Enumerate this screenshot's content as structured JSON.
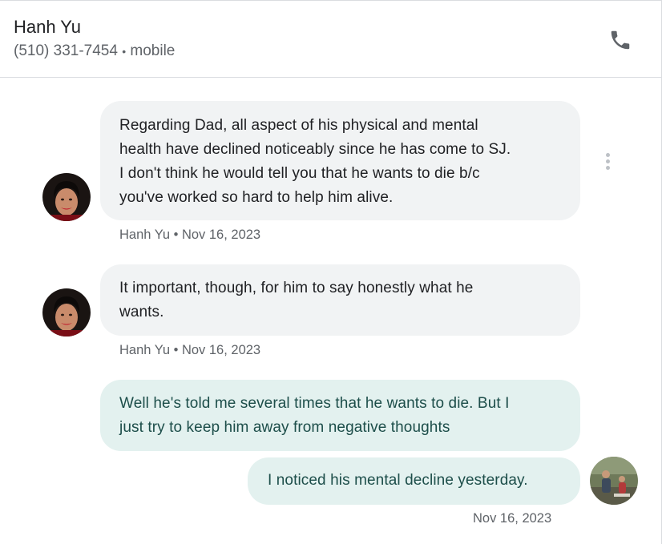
{
  "header": {
    "contact_name": "Hanh Yu",
    "phone": "(510) 331-7454",
    "phone_type": "mobile",
    "separator": "•",
    "call_icon": "phone-icon"
  },
  "messages": [
    {
      "direction": "incoming",
      "lines": [
        "Regarding Dad, all aspect of his physical and mental",
        "health have declined noticeably since he has come to SJ.",
        "I don't think he would tell you that he wants to die b/c",
        "you've worked so hard to help him alive."
      ],
      "meta": "Hanh Yu • Nov 16, 2023"
    },
    {
      "direction": "incoming",
      "lines": [
        "It important, though, for  him to say honestly what he",
        "wants."
      ],
      "meta": "Hanh Yu • Nov 16, 2023"
    },
    {
      "direction": "outgoing",
      "lines": [
        "Well he's told me several times that he wants to die. But I",
        "just try to keep him away from negative thoughts"
      ]
    },
    {
      "direction": "outgoing",
      "lines": [
        "I noticed his mental decline yesterday."
      ],
      "meta": "Nov 16, 2023"
    }
  ],
  "colors": {
    "incoming_bubble": "#f1f3f4",
    "outgoing_bubble": "#e3f1ef",
    "outgoing_text": "#1d4e4a",
    "secondary_text": "#5f6368"
  },
  "icons": {
    "more": "more-vert-icon"
  }
}
